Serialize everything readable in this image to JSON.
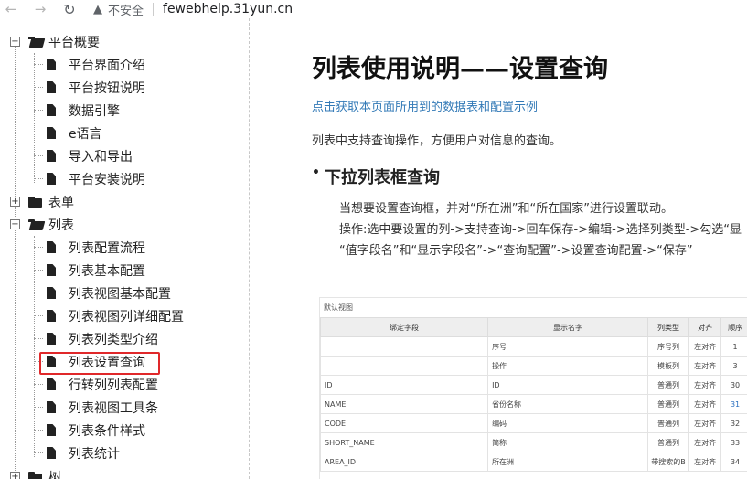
{
  "browser": {
    "back_icon": "arrow-left-icon",
    "forward_icon": "arrow-right-icon",
    "reload_icon": "reload-icon",
    "security_icon": "warning-triangle-icon",
    "security_label": "不安全",
    "url": "fewebhelp.31yun.cn"
  },
  "tree": {
    "g1": {
      "label": "平台概要",
      "toggle": "−",
      "items": [
        "平台界面介绍",
        "平台按钮说明",
        "数据引擎",
        "e语言",
        "导入和导出",
        "平台安装说明"
      ]
    },
    "g2": {
      "label": "表单",
      "toggle": "+"
    },
    "g3": {
      "label": "列表",
      "toggle": "−",
      "items": [
        "列表配置流程",
        "列表基本配置",
        "列表视图基本配置",
        "列表视图列详细配置",
        "列表列类型介绍",
        "列表设置查询",
        "行转列列表配置",
        "列表视图工具条",
        "列表条件样式",
        "列表统计"
      ]
    },
    "g4": {
      "label": "树",
      "toggle": "+"
    },
    "selected": "列表设置查询",
    "highlight_color": "#e0282a"
  },
  "content": {
    "title": "列表使用说明——设置查询",
    "link": "点击获取本页面所用到的数据表和配置示例",
    "intro": "列表中支持查询操作，方便用户对信息的查询。",
    "section_title": "下拉列表框查询",
    "desc1": "当想要设置查询框，并对“所在洲”和“所在国家”进行设置联动。",
    "desc2": "操作:选中要设置的列->支持查询->回车保存->编辑->选择列类型->勾选“显",
    "desc3": "“值字段名”和“显示字段名”->“查询配置”->设置查询配置->“保存”",
    "link_color": "#337ab7"
  },
  "screenshot_table": {
    "caption": "默认视图",
    "headers": [
      "绑定字段",
      "显示名字",
      "列类型",
      "对齐",
      "顺序"
    ],
    "rows": [
      [
        "",
        "序号",
        "序号列",
        "左对齐",
        "1"
      ],
      [
        "",
        "操作",
        "模板列",
        "左对齐",
        "3"
      ],
      [
        "ID",
        "ID",
        "普通列",
        "左对齐",
        "30"
      ],
      [
        "NAME",
        "省份名称",
        "普通列",
        "左对齐",
        "31"
      ],
      [
        "CODE",
        "编码",
        "普通列",
        "左对齐",
        "32"
      ],
      [
        "SHORT_NAME",
        "简称",
        "普通列",
        "左对齐",
        "33"
      ],
      [
        "AREA_ID",
        "所在洲",
        "带搜索的B",
        "左对齐",
        "34"
      ]
    ]
  }
}
